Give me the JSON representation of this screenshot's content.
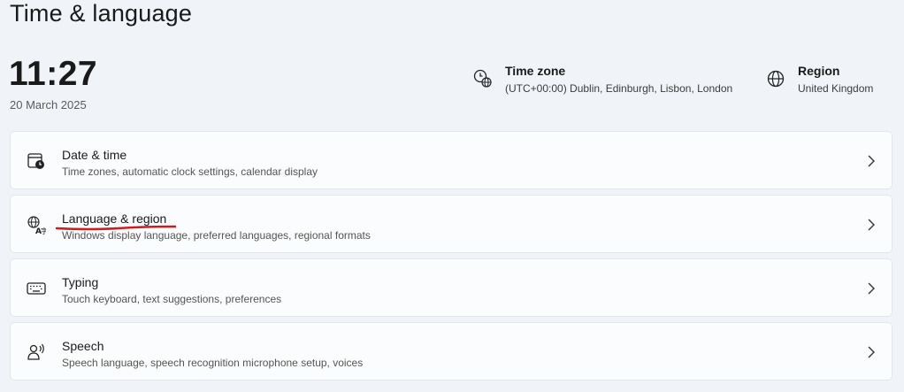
{
  "header": {
    "title": "Time & language"
  },
  "clock": {
    "time": "11:27",
    "date": "20 March 2025"
  },
  "time_zone": {
    "icon": "clock-globe-icon",
    "title": "Time zone",
    "value": "(UTC+00:00) Dublin, Edinburgh, Lisbon, London"
  },
  "region": {
    "icon": "globe-icon",
    "title": "Region",
    "value": "United Kingdom"
  },
  "cards": [
    {
      "icon": "calendar-clock-icon",
      "title": "Date & time",
      "description": "Time zones, automatic clock settings, calendar display"
    },
    {
      "icon": "language-icon",
      "title": "Language & region",
      "description": "Windows display language, preferred languages, regional formats"
    },
    {
      "icon": "keyboard-icon",
      "title": "Typing",
      "description": "Touch keyboard, text suggestions, preferences"
    },
    {
      "icon": "speech-icon",
      "title": "Speech",
      "description": "Speech language, speech recognition microphone setup, voices"
    }
  ],
  "annotation_color": "#d01c1c"
}
